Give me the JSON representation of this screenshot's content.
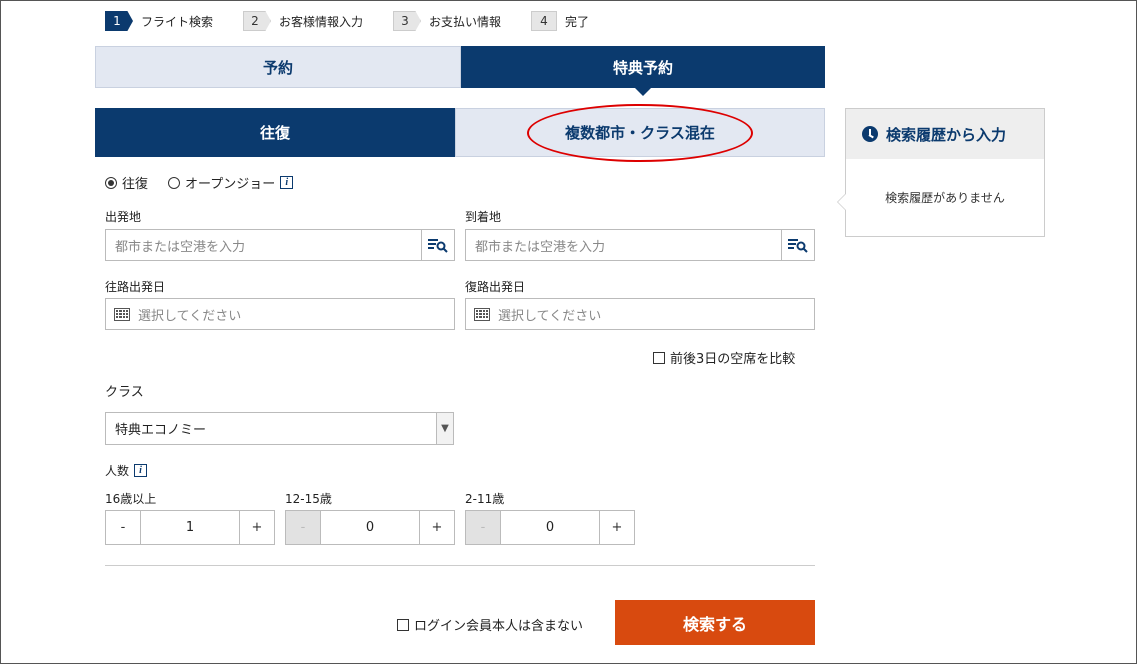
{
  "steps": [
    {
      "num": "1",
      "label": "フライト検索"
    },
    {
      "num": "2",
      "label": "お客様情報入力"
    },
    {
      "num": "3",
      "label": "お支払い情報"
    },
    {
      "num": "4",
      "label": "完了"
    }
  ],
  "top_tabs": {
    "reservation": "予約",
    "award": "特典予約"
  },
  "sub_tabs": {
    "roundtrip": "往復",
    "multicity": "複数都市・クラス混在"
  },
  "trip_type": {
    "roundtrip": "往復",
    "openjaw": "オープンジョー",
    "selected": "往復"
  },
  "origin": {
    "label": "出発地",
    "placeholder": "都市または空港を入力"
  },
  "destination": {
    "label": "到着地",
    "placeholder": "都市または空港を入力"
  },
  "depart_date": {
    "label": "往路出発日",
    "placeholder": "選択してください"
  },
  "return_date": {
    "label": "復路出発日",
    "placeholder": "選択してください"
  },
  "compare_label": "前後3日の空席を比較",
  "cabin": {
    "label": "クラス",
    "value": "特典エコノミー"
  },
  "passengers": {
    "label": "人数",
    "groups": [
      {
        "label": "16歳以上",
        "value": "1",
        "minus": "-",
        "plus": "+"
      },
      {
        "label": "12-15歳",
        "value": "0",
        "minus": "-",
        "plus": "+"
      },
      {
        "label": "2-11歳",
        "value": "0",
        "minus": "-",
        "plus": "+"
      }
    ]
  },
  "exclude_member_label": "ログイン会員本人は含まない",
  "search_button": "検索する",
  "history": {
    "title": "検索履歴から入力",
    "empty": "検索履歴がありません"
  },
  "colors": {
    "navy": "#0b3a6e",
    "light_tab": "#e3e8f2",
    "accent": "#d84a0f",
    "annotation": "#dd0000"
  }
}
